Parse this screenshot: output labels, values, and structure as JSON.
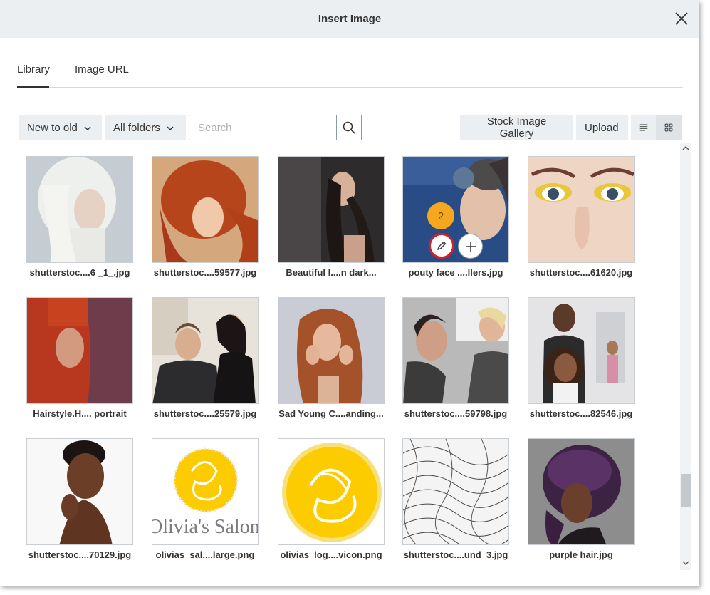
{
  "dialog": {
    "title": "Insert Image"
  },
  "tabs": [
    {
      "label": "Library",
      "active": true
    },
    {
      "label": "Image URL",
      "active": false
    }
  ],
  "toolbar": {
    "sort_label": "New to old",
    "folder_label": "All folders",
    "search_placeholder": "Search",
    "stock_label": "Stock Image Gallery",
    "upload_label": "Upload"
  },
  "images": [
    {
      "caption": "shutterstoc....6 _1_.jpg"
    },
    {
      "caption": "shutterstoc....59577.jpg"
    },
    {
      "caption": "Beautiful l....n dark..."
    },
    {
      "caption": "pouty face ....llers.jpg",
      "badge": "2"
    },
    {
      "caption": "shutterstoc....61620.jpg"
    },
    {
      "caption": "Hairstyle.H.... portrait"
    },
    {
      "caption": "shutterstoc....25579.jpg"
    },
    {
      "caption": "Sad Young C....anding..."
    },
    {
      "caption": "shutterstoc....59798.jpg"
    },
    {
      "caption": "shutterstoc....82546.jpg"
    },
    {
      "caption": "shutterstoc....70129.jpg"
    },
    {
      "caption": "olivias_sal....large.png",
      "logo_text": "Olivia's Salon"
    },
    {
      "caption": "olivias_log....vicon.png"
    },
    {
      "caption": "shutterstoc....und_3.jpg"
    },
    {
      "caption": "purple hair.jpg"
    }
  ],
  "colors": {
    "accent_badge": "#f5a81e",
    "edit_ring": "#d3202a",
    "header_bg": "#eceff1"
  }
}
